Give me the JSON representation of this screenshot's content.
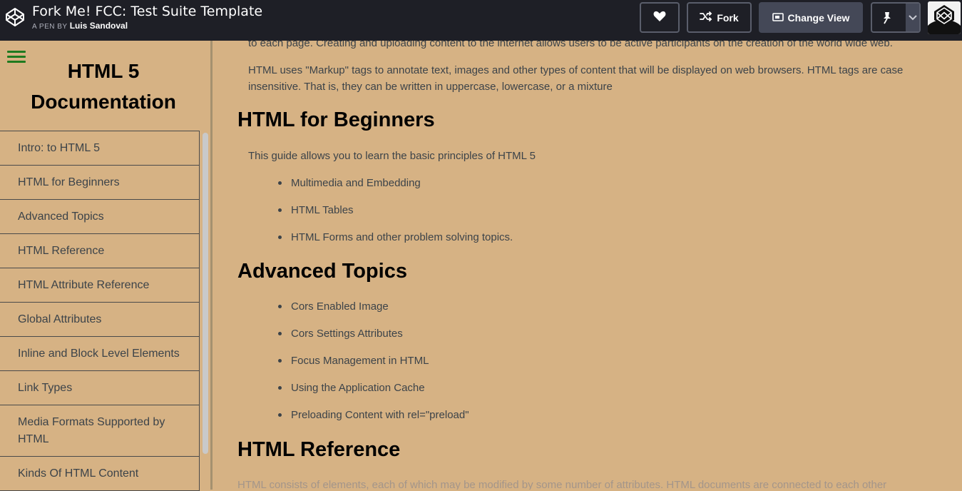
{
  "topbar": {
    "title": "Fork Me! FCC: Test Suite Template",
    "byline_prefix": "A PEN BY",
    "author": "Luis Sandoval",
    "fork_label": "Fork",
    "change_view_label": "Change View",
    "icons": [
      "codepen-logo-icon",
      "heart-icon",
      "fork-icon",
      "change-view-icon",
      "pin-icon",
      "chevron-down-icon"
    ]
  },
  "sidebar": {
    "title_line1": "HTML 5",
    "title_line2": "Documentation",
    "items": [
      {
        "label": "Intro: to HTML 5"
      },
      {
        "label": "HTML for Beginners"
      },
      {
        "label": "Advanced Topics"
      },
      {
        "label": "HTML Reference"
      },
      {
        "label": "HTML Attribute Reference"
      },
      {
        "label": "Global Attributes"
      },
      {
        "label": "Inline and Block Level Elements"
      },
      {
        "label": "Link Types"
      },
      {
        "label": "Media Formats Supported by HTML"
      },
      {
        "label": "Kinds Of HTML Content"
      }
    ]
  },
  "main": {
    "intro_tail": "to each page. Creating and uploading content to the internet allows users to be active participants on the creation of the world wide web.",
    "intro_markup": "HTML uses \"Markup\" tags to annotate text, images and other types of content that will be displayed on web browsers. HTML tags are case insensitive. That is, they can be written in uppercase, lowercase, or a mixture",
    "beginners": {
      "heading": "HTML for Beginners",
      "text": "This guide allows you to learn the basic principles of HTML 5",
      "items": [
        "Multimedia and Embedding",
        "HTML Tables",
        "HTML Forms and other problem solving topics."
      ]
    },
    "advanced": {
      "heading": "Advanced Topics",
      "items": [
        "Cors Enabled Image",
        "Cors Settings Attributes",
        "Focus Management in HTML",
        "Using the Application Cache",
        "Preloading Content with rel=\"preload\""
      ]
    },
    "reference": {
      "heading": "HTML Reference",
      "text": "HTML consists of elements, each of which may be modified by some number of attributes. HTML documents are connected to each other"
    }
  },
  "colors": {
    "topbar_bg": "#1e1f26",
    "page_bg": "#d6b284",
    "menu_icon": "#1f7a1f"
  }
}
